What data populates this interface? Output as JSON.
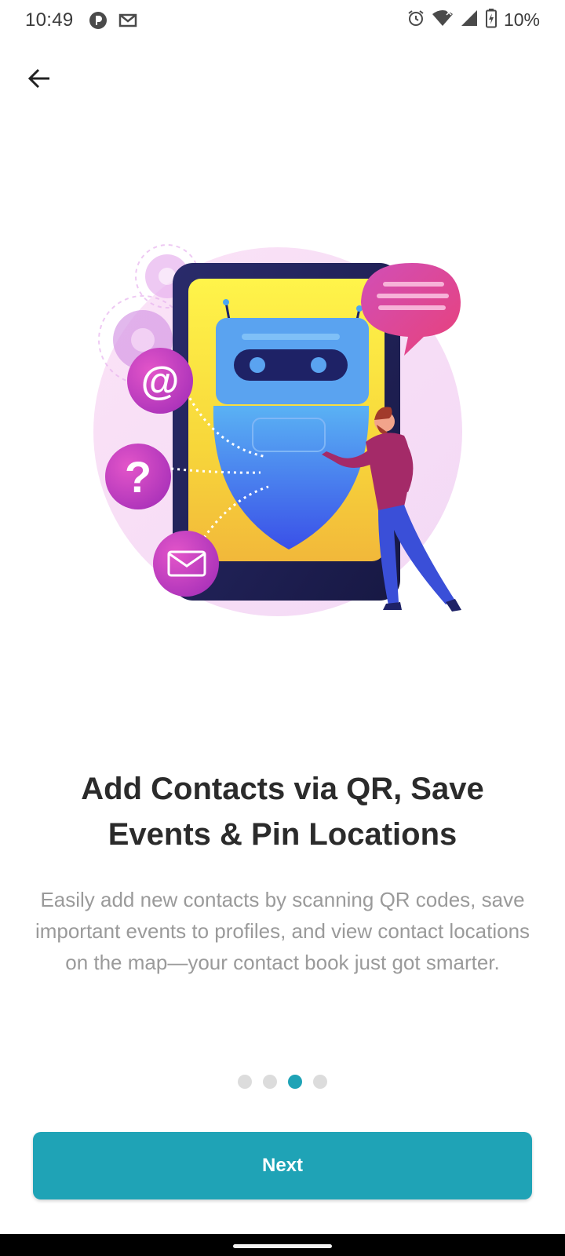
{
  "status_bar": {
    "time": "10:49",
    "battery": "10%",
    "icons_left": [
      "app-notification-icon",
      "gmail-icon"
    ],
    "icons_right": [
      "alarm-icon",
      "wifi-icon",
      "signal-icon",
      "battery-icon"
    ]
  },
  "nav": {
    "back_icon": "arrow-left-icon"
  },
  "onboarding": {
    "title": "Add Contacts via QR, Save Events & Pin Locations",
    "description": "Easily add new contacts by scanning QR codes, save important events to profiles, and view contact locations on the map—your contact book just got smarter.",
    "page_count": 4,
    "current_page": 3,
    "next_label": "Next"
  },
  "colors": {
    "accent": "#1fa3b6",
    "title": "#2b2b2b",
    "body": "#9a9a9a",
    "dot_inactive": "#dcdcdc"
  }
}
